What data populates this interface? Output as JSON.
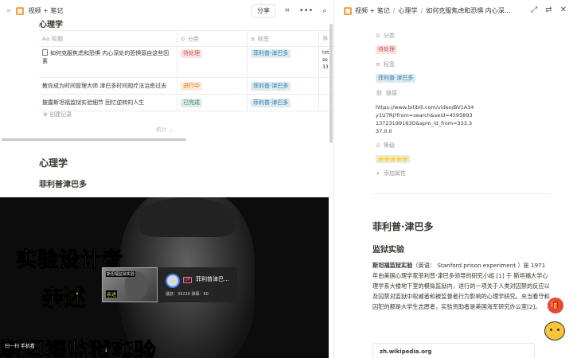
{
  "left": {
    "breadcrumb": "视频 + 笔记",
    "share_label": "分享",
    "db_title": "心理学",
    "columns": [
      "标题",
      "分类",
      "标签",
      ""
    ],
    "rows": [
      {
        "title": "如何克服焦虑和恐惧 内心深处的恐惧源自这些因素",
        "category": "待处理",
        "tag": "菲利普·津巴多",
        "link": "htt se 33"
      },
      {
        "title": "教你成为时间管理大师 津巴多时间观疗法治愈过去",
        "category": "进行中",
        "tag": "菲利普·津巴多",
        "link": ""
      },
      {
        "title": "披露斯坦福监狱实验细节 回忆逆转的人生",
        "category": "已完成",
        "tag": "菲利普·津巴多",
        "link": ""
      }
    ],
    "new_record": "创建记录",
    "count_label": "统计",
    "heading_psy": "心理学",
    "heading_fil": "菲利普津巴多",
    "video": {
      "caption1": "实验设计者",
      "caption2": "亲述",
      "caption3": "斯坦福监狱实验",
      "card_thumb_top": "斯坦福监狱实验",
      "card_thumb_bottom": "亲述",
      "up_badge": "UP",
      "uploader": "菲利普津巴...",
      "stats": "播放：39226    弹幕：60",
      "scan": "扫一扫 手机看"
    }
  },
  "right": {
    "breadcrumb": [
      "视频 + 笔记",
      "心理学",
      "如何克服焦虑和恐惧 内心深处的恐..."
    ],
    "props": {
      "category_label": "分类",
      "category_value": "待处理",
      "tag_label": "标签",
      "tag_value": "菲利普·津巴多",
      "link_label": "链接",
      "link_value": "https://www.bilibili.com/video/BV1A34y1U7Rj?from=search&seid=459589313723199163O&spm_id_from=333.337.0.0",
      "level_label": "等级",
      "level_value": "⭐⭐⭐⭐⭐",
      "add_prop": "添加属性"
    },
    "h1": "菲利普·津巴多",
    "h2": "监狱实验",
    "para_bold": "斯坦福监狱实验",
    "para_rest": "（英语： Stanford prison experiment ）是 1971 年由美国心理学家菲利普·津巴多领导的研究小组 [1] 于 斯坦福大学心理学系大楼地下室的模拟监狱内，进行的一项关于人类对囚禁的反应以及囚禁对监狱中权威者和被监督者行为影响的心理学研究。充当看守和囚犯的都是大学生志愿者，实验资助者是美国海军研究办公室[2]。",
    "wiki": "zh.wikipedia.org"
  }
}
